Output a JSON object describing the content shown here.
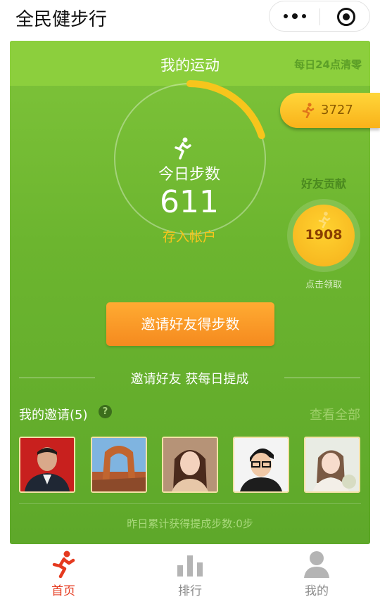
{
  "app": {
    "title": "全民健步行"
  },
  "card": {
    "title": "我的运动",
    "reset_note": "每日24点清零",
    "today_label": "今日步数",
    "today_count": "611",
    "deposit_label": "存入帐户",
    "today_progress_fraction": 0.2,
    "total_steps": "3727",
    "friend_label": "好友贡献",
    "friend_steps": "1908",
    "claim_hint": "点击领取",
    "invite_button": "邀请好友得步数",
    "divider_text": "邀请好友 获每日提成",
    "my_invites": "我的邀请(5)",
    "view_all": "查看全部",
    "yesterday": "昨日累计获得提成步数:0步"
  },
  "tabs": [
    {
      "label": "首页",
      "active": true
    },
    {
      "label": "排行",
      "active": false
    },
    {
      "label": "我的",
      "active": false
    }
  ],
  "colors": {
    "card_green": "#6cb52f",
    "header_green": "#8ccf3d",
    "accent_yellow": "#f7c51c",
    "button_orange": "#f58a1f",
    "tab_active": "#e53a1f"
  }
}
